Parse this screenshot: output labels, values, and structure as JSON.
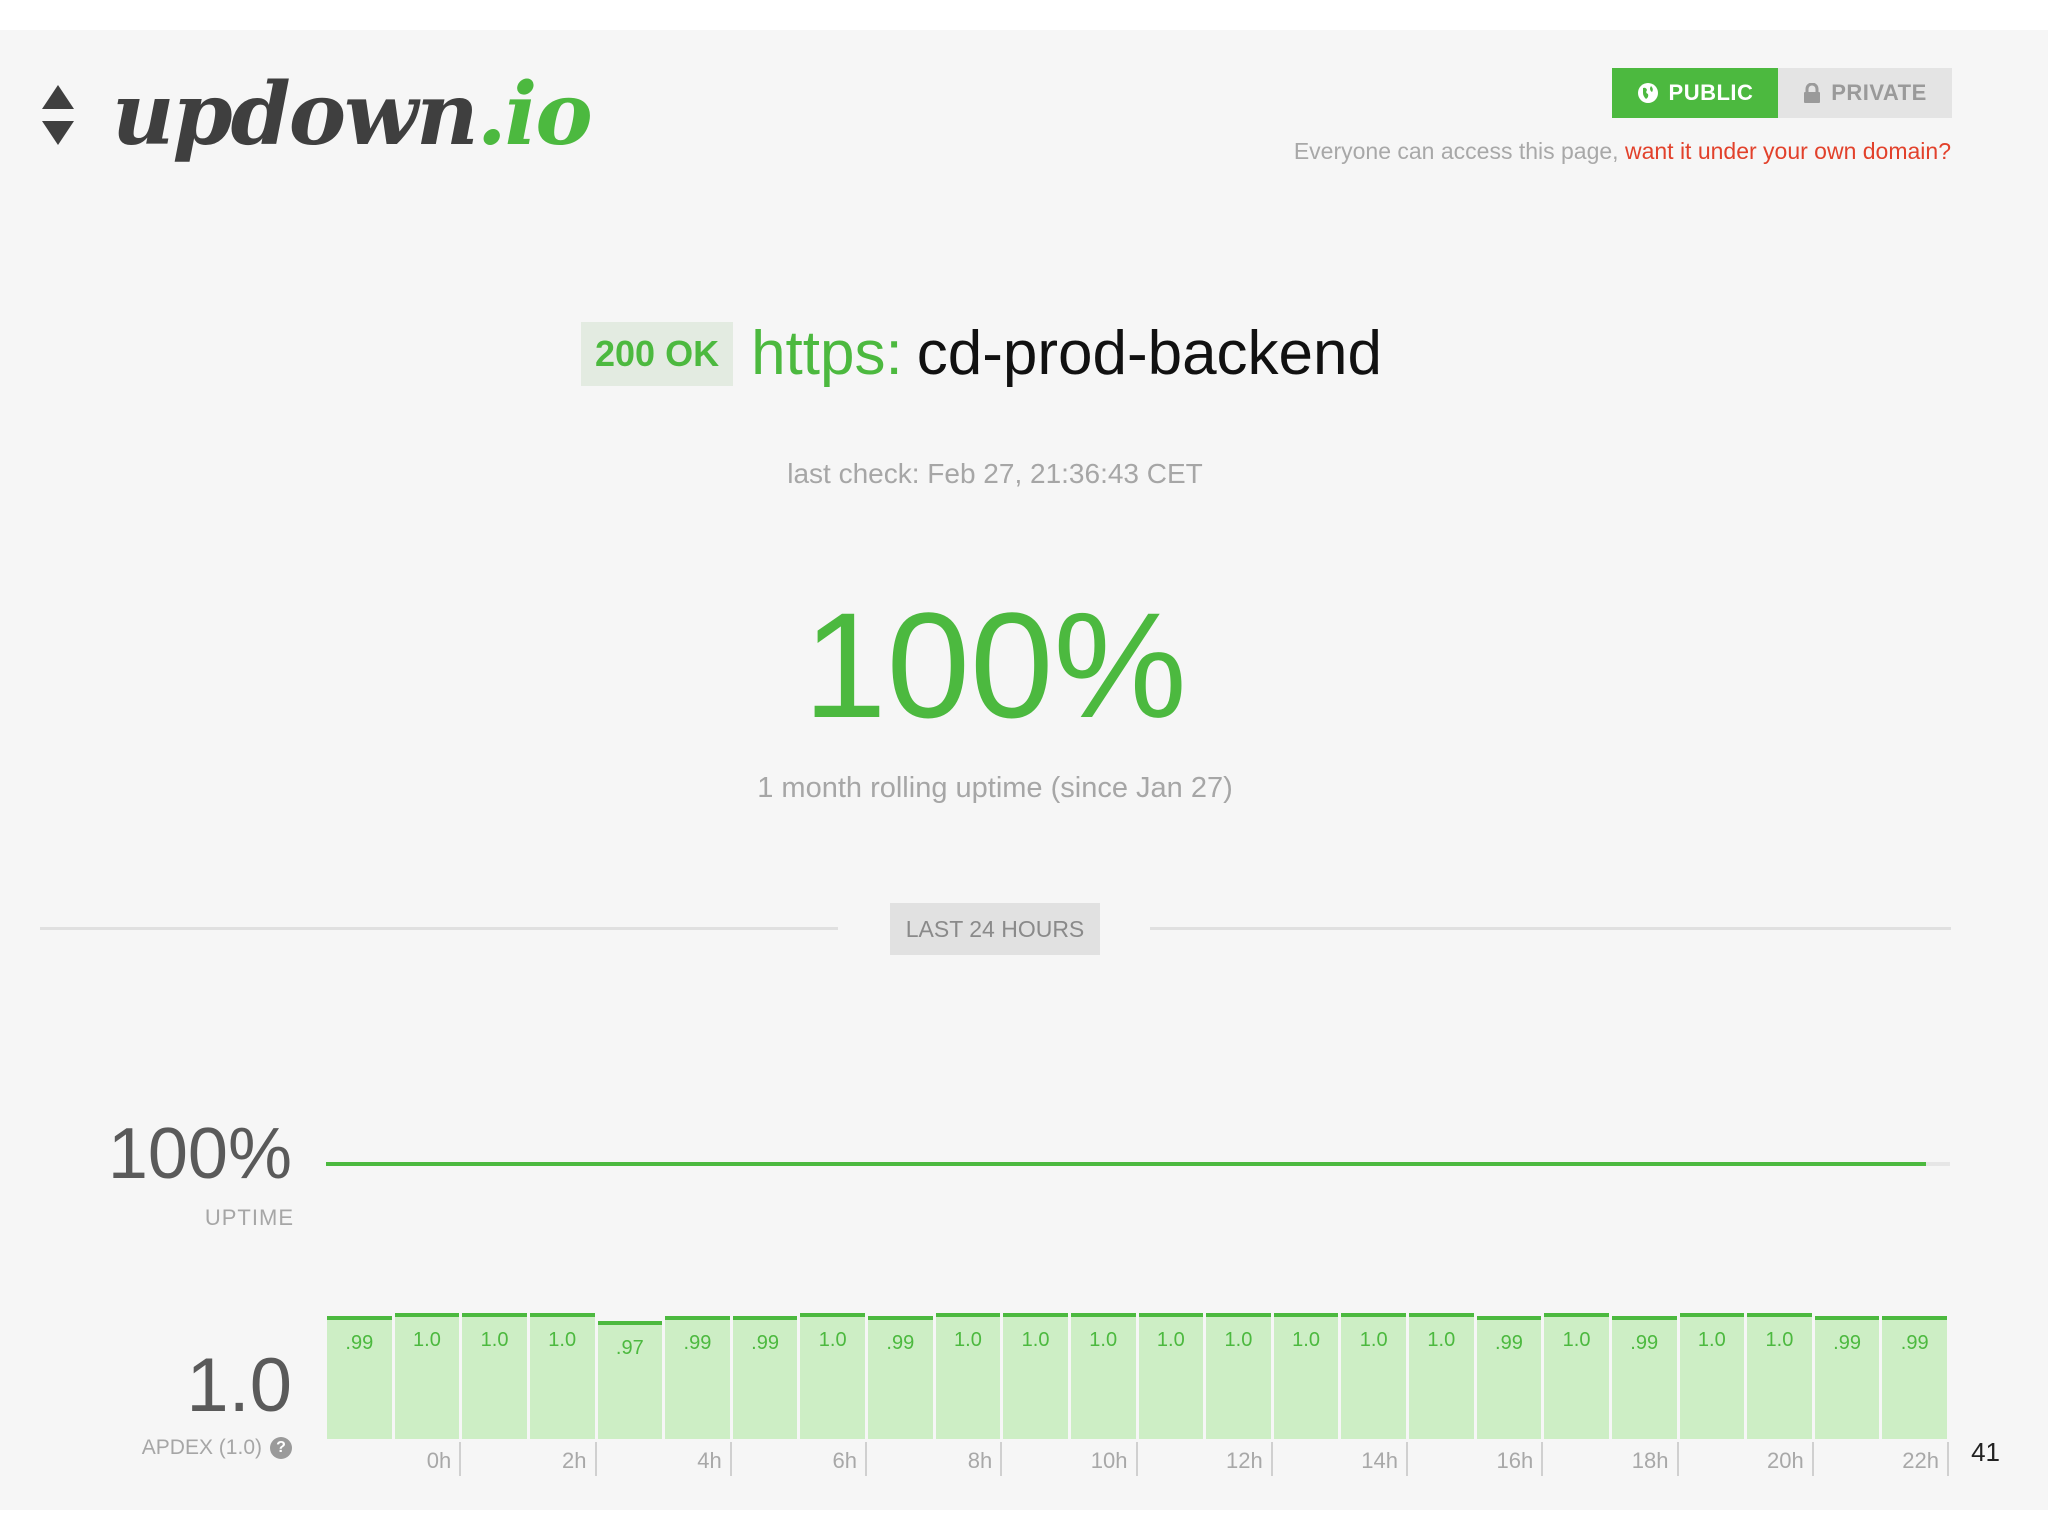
{
  "brand": {
    "name_main": "updown",
    "name_tld": ".io"
  },
  "visibility": {
    "public_label": "PUBLIC",
    "private_label": "PRIVATE",
    "note_prefix": "Everyone can access this page,",
    "note_link": "want it under your own domain?"
  },
  "check": {
    "status": "200 OK",
    "protocol": "https:",
    "host": "cd-prod-backend",
    "last_check": "last check: Feb 27, 21:36:43 CET",
    "uptime": "100%",
    "uptime_caption": "1 month rolling uptime (since Jan 27)"
  },
  "section": {
    "label": "LAST 24 HOURS"
  },
  "uptime_row": {
    "value": "100%",
    "label": "UPTIME",
    "fill_fraction": 0.985
  },
  "apdex_row": {
    "value": "1.0",
    "label": "APDEX (1.0)",
    "help_icon": "question-circle-icon"
  },
  "apdex_hours": [
    {
      "label": ".99",
      "value": 0.99
    },
    {
      "label": "1.0",
      "value": 1.0
    },
    {
      "label": "1.0",
      "value": 1.0
    },
    {
      "label": "1.0",
      "value": 1.0
    },
    {
      "label": ".97",
      "value": 0.97
    },
    {
      "label": ".99",
      "value": 0.99
    },
    {
      "label": ".99",
      "value": 0.99
    },
    {
      "label": "1.0",
      "value": 1.0
    },
    {
      "label": ".99",
      "value": 0.99
    },
    {
      "label": "1.0",
      "value": 1.0
    },
    {
      "label": "1.0",
      "value": 1.0
    },
    {
      "label": "1.0",
      "value": 1.0
    },
    {
      "label": "1.0",
      "value": 1.0
    },
    {
      "label": "1.0",
      "value": 1.0
    },
    {
      "label": "1.0",
      "value": 1.0
    },
    {
      "label": "1.0",
      "value": 1.0
    },
    {
      "label": "1.0",
      "value": 1.0
    },
    {
      "label": ".99",
      "value": 0.99
    },
    {
      "label": "1.0",
      "value": 1.0
    },
    {
      "label": ".99",
      "value": 0.99
    },
    {
      "label": "1.0",
      "value": 1.0
    },
    {
      "label": "1.0",
      "value": 1.0
    },
    {
      "label": ".99",
      "value": 0.99
    },
    {
      "label": ".99",
      "value": 0.99
    }
  ],
  "hour_labels": [
    "0h",
    "2h",
    "4h",
    "6h",
    "8h",
    "10h",
    "12h",
    "14h",
    "16h",
    "18h",
    "20h",
    "22h"
  ],
  "slide_number": "41",
  "colors": {
    "accent": "#4cb93f",
    "link": "#e2412b",
    "bar_fill": "#cdeec5"
  }
}
